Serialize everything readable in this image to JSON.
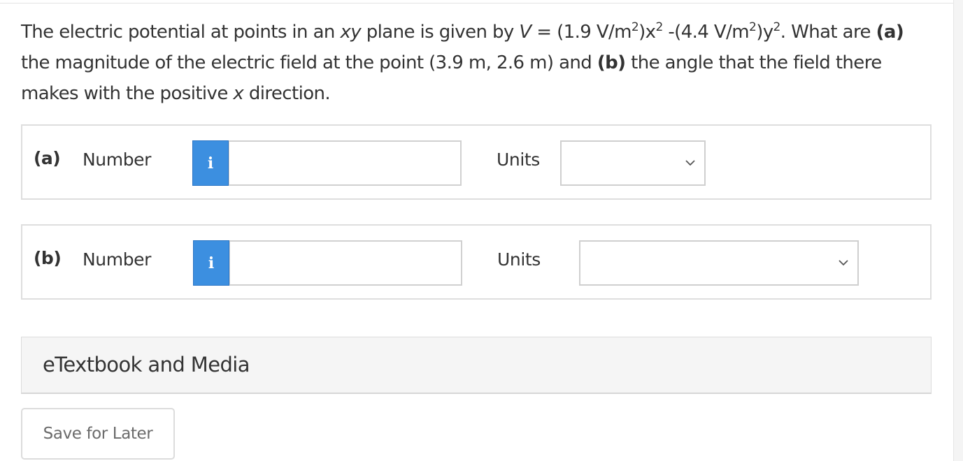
{
  "question": {
    "intro": "The electric potential at points in an ",
    "plane_var": "xy",
    "plane_text": " plane is given by ",
    "v_symbol": "V",
    "eq_part1": " = (1.9 V/m",
    "exp1": "2",
    "eq_part2": ")x",
    "exp2": "2",
    "eq_part3": " -(4.4 V/m",
    "exp3": "2",
    "eq_part4": ")y",
    "exp4": "2",
    "eq_part5": ". What are ",
    "label_a": "(a)",
    "text_a": " the magnitude of the electric field at the point (3.9 m, 2.6 m) and ",
    "label_b": "(b)",
    "text_b": " the angle that the field there makes with the positive ",
    "x_var": "x",
    "text_end": " direction."
  },
  "part_a": {
    "letter": "(a)",
    "label": "Number",
    "info_icon": "i",
    "input_value": "",
    "units_label": "Units",
    "units_selected": ""
  },
  "part_b": {
    "letter": "(b)",
    "label": "Number",
    "info_icon": "i",
    "input_value": "",
    "units_label": "Units",
    "units_selected": ""
  },
  "media": {
    "label": "eTextbook and Media"
  },
  "actions": {
    "save_label": "Save for Later"
  },
  "colors": {
    "info_blue": "#3c8fe0",
    "text": "#333333",
    "border": "#dedede"
  }
}
